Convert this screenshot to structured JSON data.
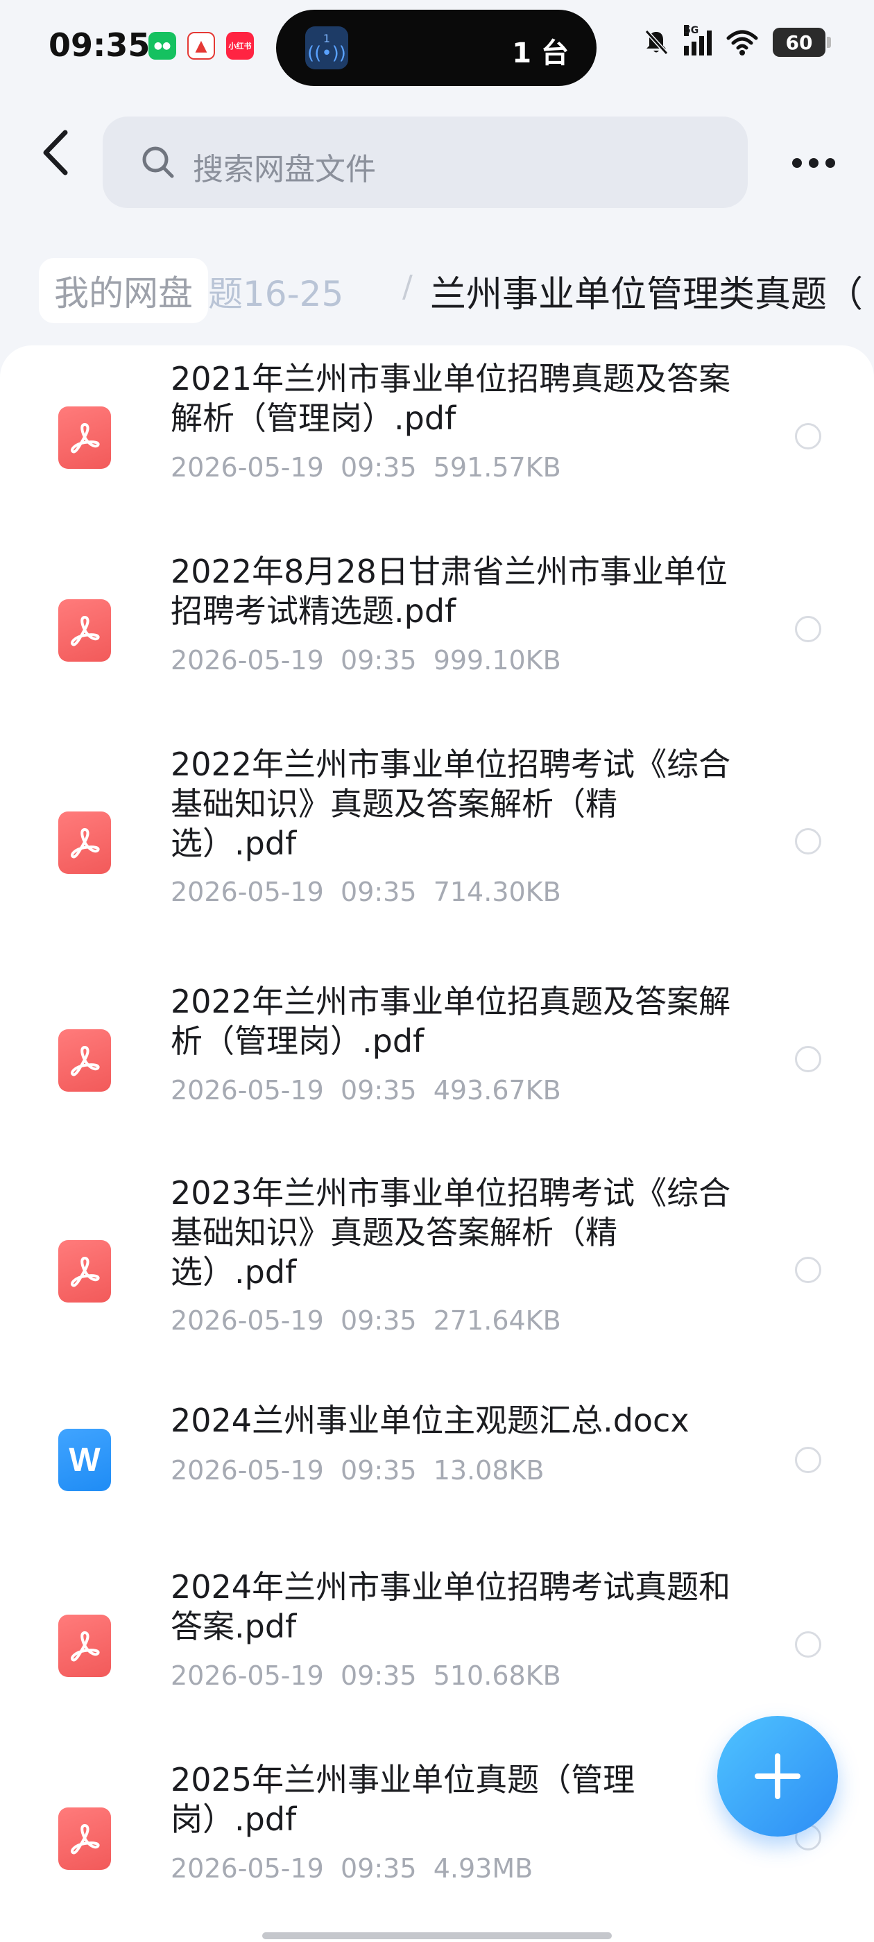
{
  "status_bar": {
    "time": "09:35",
    "apps": [
      "微信",
      "A",
      "小红书"
    ],
    "island_count": "1",
    "island_text": "1 台",
    "network": "5G",
    "battery": "60"
  },
  "search": {
    "placeholder": "搜索网盘文件"
  },
  "breadcrumb": {
    "root": "我的网盘",
    "faded": "题16-25",
    "separator": "/",
    "current": "兰州事业单位管理类真题（"
  },
  "files": [
    {
      "type": "pdf",
      "name": "2021年兰州市事业单位招聘真题及答案解析（管理岗）.pdf",
      "date": "2026-05-19",
      "time": "09:35",
      "size": "591.57KB"
    },
    {
      "type": "pdf",
      "name": "2022年8月28日甘肃省兰州市事业单位招聘考试精选题.pdf",
      "date": "2026-05-19",
      "time": "09:35",
      "size": "999.10KB"
    },
    {
      "type": "pdf",
      "name": "2022年兰州市事业单位招聘考试《综合基础知识》真题及答案解析（精选）.pdf",
      "date": "2026-05-19",
      "time": "09:35",
      "size": "714.30KB"
    },
    {
      "type": "pdf",
      "name": "2022年兰州市事业单位招真题及答案解析（管理岗）.pdf",
      "date": "2026-05-19",
      "time": "09:35",
      "size": "493.67KB"
    },
    {
      "type": "pdf",
      "name": "2023年兰州市事业单位招聘考试《综合基础知识》真题及答案解析（精选）.pdf",
      "date": "2026-05-19",
      "time": "09:35",
      "size": "271.64KB"
    },
    {
      "type": "word",
      "name": "2024兰州事业单位主观题汇总.docx",
      "date": "2026-05-19",
      "time": "09:35",
      "size": "13.08KB"
    },
    {
      "type": "pdf",
      "name": "2024年兰州市事业单位招聘考试真题和答案.pdf",
      "date": "2026-05-19",
      "time": "09:35",
      "size": "510.68KB"
    },
    {
      "type": "pdf",
      "name": "2025年兰州事业单位真题（管理岗）.pdf",
      "date": "2026-05-19",
      "time": "09:35",
      "size": "4.93MB"
    }
  ],
  "word_icon_letter": "W",
  "colors": {
    "accent": "#2d8df5",
    "pdf_icon": "#f25a5a",
    "word_icon": "#1f8cf5",
    "meta_text": "#a6aab3"
  },
  "icons": {
    "back": "chevron-left-icon",
    "search": "search-icon",
    "more": "more-dots-icon",
    "pdf": "pdf-file-icon",
    "word": "word-file-icon",
    "add": "plus-icon"
  }
}
